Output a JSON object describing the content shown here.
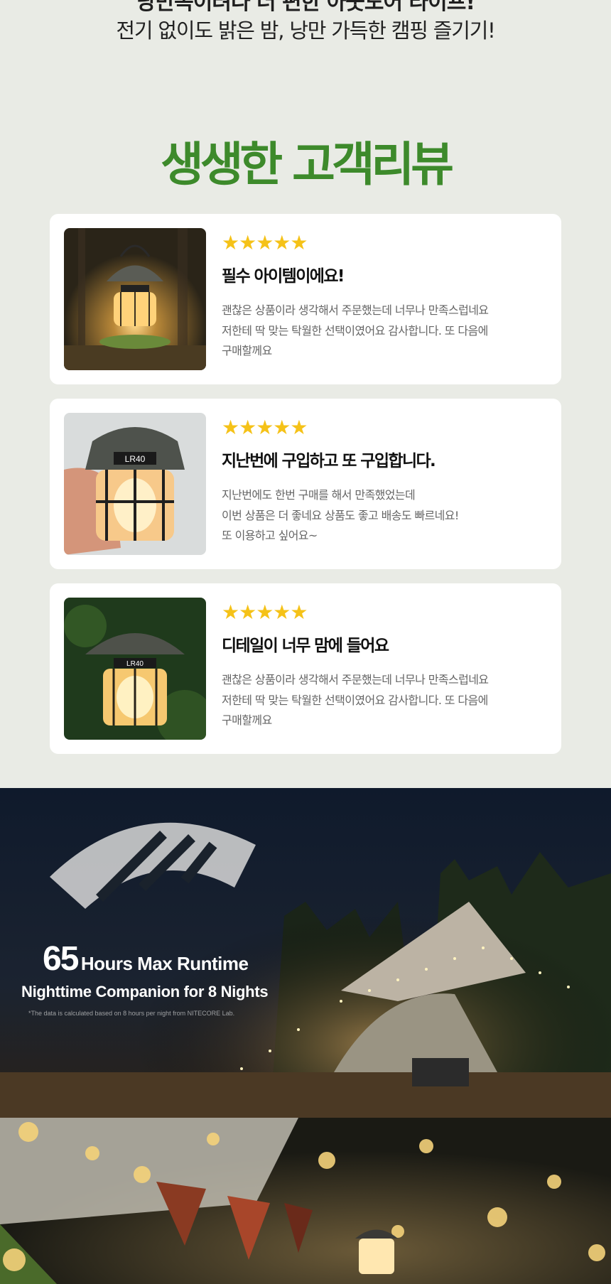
{
  "header": {
    "cut_headline": "낭만속이려다 더 편한 아웃도어 라이프!",
    "subtitle": "전기 없이도 밝은 밤, 낭만 가득한 캠핑 즐기기!"
  },
  "reviews_section": {
    "title": "생생한 고객리뷰",
    "reviews": [
      {
        "stars": "★★★★★",
        "rating": 5,
        "title": "필수 아이템이에요!",
        "body_lines": [
          "괜찮은 상품이라 생각해서 주문했는데 너무나 만족스럽네요",
          "저한테 딱 맞는 탁월한 선택이였어요 감사합니다. 또 다음에",
          "구매할께요"
        ]
      },
      {
        "stars": "★★★★★",
        "rating": 5,
        "title": "지난번에 구입하고 또 구입합니다.",
        "body_lines": [
          "지난번에도 한번 구매를 해서 만족했었는데",
          "이번 상품은 더 좋네요 상품도 좋고 배송도 빠르네요!",
          "또 이용하고 싶어요~"
        ]
      },
      {
        "stars": "★★★★★",
        "rating": 5,
        "title": "디테일이 너무 맘에 들어요",
        "body_lines": [
          "괜찮은 상품이라 생각해서 주문했는데 너무나 만족스럽네요",
          "저한테 딱 맞는 탁월한 선택이였어요 감사합니다. 또 다음에",
          "구매할께요"
        ]
      }
    ]
  },
  "runtime_banner": {
    "number": "65",
    "headline_rest": "Hours Max Runtime",
    "line2": "Nighttime Companion for 8 Nights",
    "note": "*The data is calculated based on 8 hours per night from NITECORE Lab."
  },
  "lantern_labels": {
    "brand": "NITECORE",
    "model": "LR40",
    "tag": "Lantern"
  },
  "colors": {
    "page_bg": "#e9ebe5",
    "title_green": "#3d8a2b",
    "star_yellow": "#f5c218",
    "card_bg": "#ffffff"
  }
}
